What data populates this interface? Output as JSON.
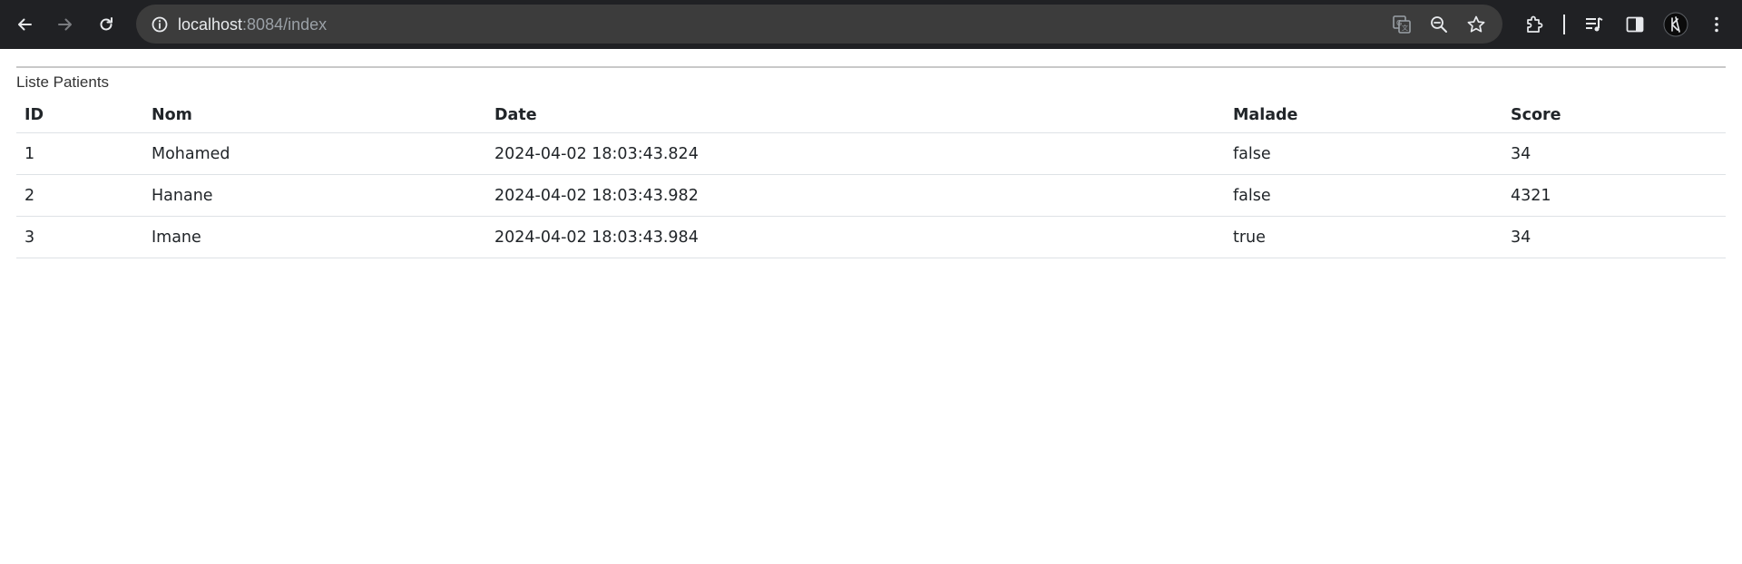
{
  "browser": {
    "url_host": "localhost",
    "url_rest": ":8084/index"
  },
  "page": {
    "caption": "Liste Patients",
    "columns": [
      "ID",
      "Nom",
      "Date",
      "Malade",
      "Score"
    ],
    "rows": [
      [
        "1",
        "Mohamed",
        "2024-04-02 18:03:43.824",
        "false",
        "34"
      ],
      [
        "2",
        "Hanane",
        "2024-04-02 18:03:43.982",
        "false",
        "4321"
      ],
      [
        "3",
        "Imane",
        "2024-04-02 18:03:43.984",
        "true",
        "34"
      ]
    ]
  },
  "colors": {
    "toolbar_bg": "#202124",
    "omnibox_bg": "#3c3c3c",
    "icon": "#e8eaed",
    "icon_disabled": "#7a7c80"
  },
  "icons": {
    "back": "arrow-left-icon",
    "forward": "arrow-right-icon",
    "reload": "reload-icon",
    "site_info": "info-icon",
    "translate": "translate-icon",
    "zoom": "zoom-out-icon",
    "bookmark": "star-icon",
    "extensions": "puzzle-icon",
    "media": "media-control-icon",
    "side_panel": "side-panel-icon",
    "profile": "profile-avatar-icon",
    "menu": "kebab-menu-icon"
  }
}
